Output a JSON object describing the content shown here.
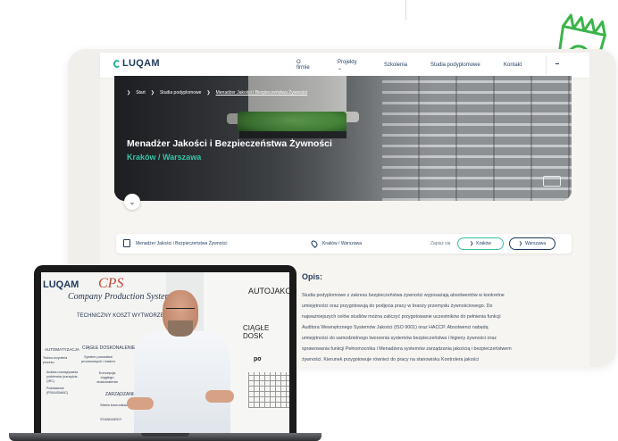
{
  "nav": {
    "logo": "LUQAM",
    "items": [
      "O firmie",
      "Projekty",
      "Szkolenia",
      "Studia podyplomowe",
      "Kontakt"
    ],
    "projekty_caret": "⌄"
  },
  "breadcrumb": {
    "items": [
      "Start",
      "Studia podyplomowe",
      "Menadżer Jakości i Bezpieczeństwa Żywności"
    ],
    "separator": "❯"
  },
  "hero": {
    "title": "Menadżer Jakości i Bezpieczeństwa Żywności",
    "subtitle": "Kraków / Warszawa",
    "chevron": "⌄"
  },
  "info_strip": {
    "course": "Menadżer Jakości i Bezpieczeństwa Żywności",
    "location": "Kraków / Warszawa",
    "signup_label": "Zapisz się",
    "buttons": [
      "Kraków",
      "Warszawa"
    ],
    "button_arrow": "❯"
  },
  "description": {
    "title": "Opis:",
    "lines": [
      "Studia podyplomowe z zakresu bezpieczeństwa żywności wyposażają absolwentów w konkretne",
      "umiejętności oraz przygotowują do podjęcia pracy w branży przemysłu żywnościowego. Do",
      "najważniejszych celów studiów można zaliczyć przygotowanie uczestników do pełnienia funkcji",
      "Auditora Wewnętrznego Systemów Jakości (ISO 9001) oraz HACCP. Absolwenci nabędą",
      "umiejętności do samodzielnego tworzenia systemów bezpieczeństwa i higieny żywności oraz",
      "sprawowania funkcji Pełnomocnika i Menadżera systemów zarządzania jakością i bezpieczeństwem",
      "żywności. Kierunek przygotowuje również do pracy na stanowisku Kontrolera jakości"
    ]
  },
  "video": {
    "wb_logo": "LUQAM",
    "wb_cps": "CPS",
    "wb_company": "Company Production System",
    "wb_tkw": "TECHNICZNY KOSZT WYTWORZENIA",
    "wb_auto": "AUTOJAKOŚ",
    "wb_ciagle": "CIĄGŁE DOSK",
    "wb_po": "po",
    "wb_cd": "CIĄGŁE DOSKONALENIE",
    "wb_sys": "System ponadtów procesowych i kaizen",
    "wb_konc": "Koncepcja ciągłego doskonalenia",
    "wb_autom": "AUTOMATYZACJA",
    "wb_small1": "Techno-inżynieria procesu",
    "wb_small2": "Analiza rozwiązywania problemów (narzędzia QRC)",
    "wb_small3": "Podstawowe (PDKA/DMAIC)",
    "wb_zarz": "ZARZĄDZANIE STRATEGIĄ",
    "wb_strat": "Strefa komunikacyjna",
    "wb_std": "STANDARDY"
  },
  "colors": {
    "brand_navy": "#1f3a5c",
    "accent_teal": "#35c2a7",
    "icon_green": "#3bb54a"
  },
  "icons": {
    "bag": "shopping-bag-leaf-icon",
    "calendar": "calendar-icon",
    "pin": "location-pin-icon"
  }
}
